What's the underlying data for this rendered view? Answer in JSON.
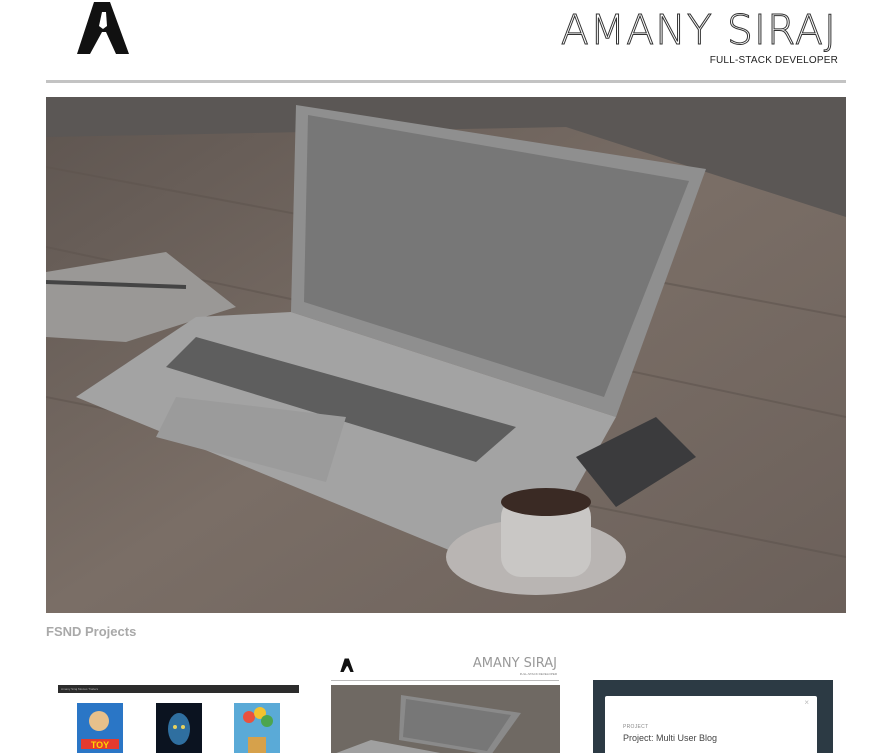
{
  "header": {
    "logo_letter": "A",
    "name": "AMANY SIRAJ",
    "title": "FULL-STACK DEVELOPER"
  },
  "hero": {
    "image": "laptop-coffee-desk-photo"
  },
  "section": {
    "title": "FSND Projects"
  },
  "cards": {
    "movie": {
      "header_text": "Amany Siraj Movies Trailers",
      "posters": [
        "Toy Story",
        "Avatar",
        "Up"
      ]
    },
    "portfolio": {
      "name": "AMANY SIRAJ",
      "title": "FULL-STACK DEVELOPER"
    },
    "blog": {
      "kicker": "PROJECT",
      "title": "Project: Multi User Blog",
      "close": "×"
    }
  }
}
